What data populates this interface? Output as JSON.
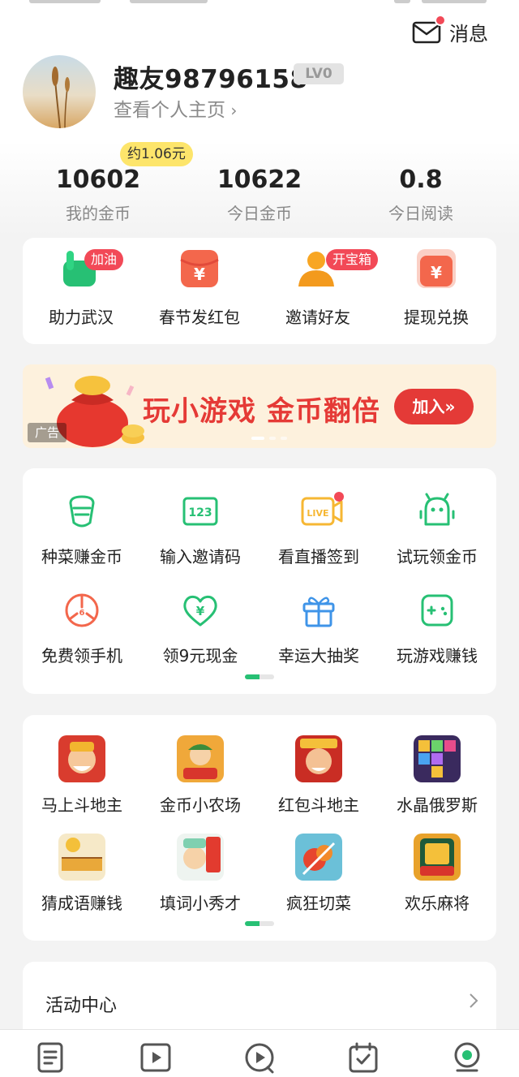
{
  "header": {
    "message_label": "消息",
    "message_icon": "mail-icon",
    "unread": true
  },
  "profile": {
    "username": "趣友98796158",
    "level": "LV0",
    "profile_link": "查看个人主页"
  },
  "stats": {
    "conversion": "约1.06元",
    "items": [
      {
        "value": "10602",
        "label": "我的金币"
      },
      {
        "value": "10622",
        "label": "今日金币"
      },
      {
        "value": "0.8",
        "label": "今日阅读"
      }
    ]
  },
  "quick_actions": [
    {
      "label": "助力武汉",
      "tag": "加油",
      "icon": "hand-thumbs-icon"
    },
    {
      "label": "春节发红包",
      "icon": "red-envelope-icon"
    },
    {
      "label": "邀请好友",
      "tag": "开宝箱",
      "icon": "person-icon"
    },
    {
      "label": "提现兑换",
      "icon": "yuan-withdraw-icon"
    }
  ],
  "banner": {
    "text": "玩小游戏 金币翻倍",
    "button": "加入»",
    "ad_label": "广告"
  },
  "tasks": [
    {
      "label": "种菜赚金币",
      "icon": "vegetable-icon"
    },
    {
      "label": "输入邀请码",
      "icon": "code-123-icon"
    },
    {
      "label": "看直播签到",
      "icon": "live-icon",
      "dot": true
    },
    {
      "label": "试玩领金币",
      "icon": "robot-icon"
    },
    {
      "label": "免费领手机",
      "icon": "phone-gift-icon"
    },
    {
      "label": "领9元现金",
      "icon": "heart-yuan-icon"
    },
    {
      "label": "幸运大抽奖",
      "icon": "gift-box-icon"
    },
    {
      "label": "玩游戏赚钱",
      "icon": "gamepad-icon"
    }
  ],
  "games": [
    {
      "label": "马上斗地主"
    },
    {
      "label": "金币小农场"
    },
    {
      "label": "红包斗地主"
    },
    {
      "label": "水晶俄罗斯"
    },
    {
      "label": "猜成语赚钱"
    },
    {
      "label": "填词小秀才"
    },
    {
      "label": "疯狂切菜"
    },
    {
      "label": "欢乐麻将"
    }
  ],
  "activity": {
    "label": "活动中心"
  },
  "tabbar": [
    {
      "icon": "news-icon"
    },
    {
      "icon": "video-icon"
    },
    {
      "icon": "short-video-icon"
    },
    {
      "icon": "task-calendar-icon"
    },
    {
      "icon": "profile-icon",
      "active": true
    }
  ],
  "colors": {
    "brand_green": "#27c074",
    "red": "#f24957",
    "banner_bg": "#fdf1dd",
    "coin_badge": "#fde56b"
  }
}
